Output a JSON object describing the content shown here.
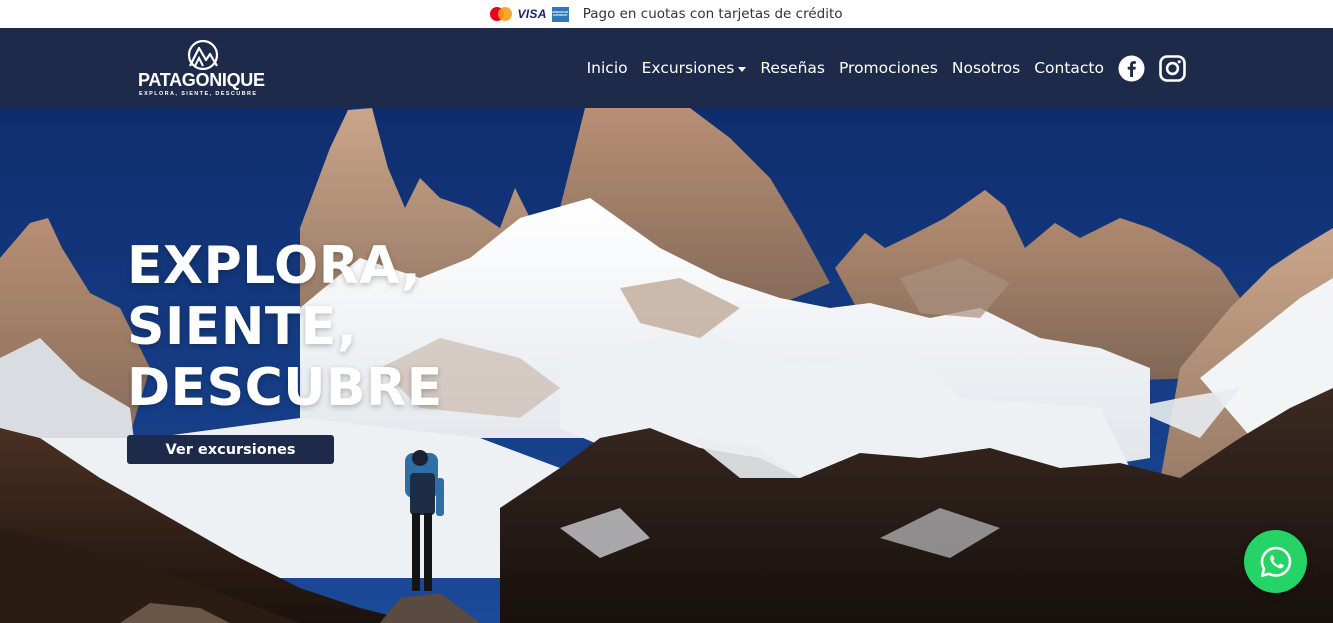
{
  "topbar": {
    "payment_icons": [
      "mastercard-icon",
      "visa-icon",
      "amex-icon"
    ],
    "visa_label": "VISA",
    "amex_label": "AMERICAN EXPRESS",
    "text": "Pago en cuotas con tarjetas de crédito"
  },
  "brand": {
    "name": "PATAGONIQUE",
    "tagline": "EXPLORA, SIENTE, DESCUBRE"
  },
  "nav": {
    "items": [
      {
        "label": "Inicio"
      },
      {
        "label": "Excursiones",
        "dropdown": true
      },
      {
        "label": "Reseñas"
      },
      {
        "label": "Promociones"
      },
      {
        "label": "Nosotros"
      },
      {
        "label": "Contacto"
      }
    ],
    "social": [
      "facebook-icon",
      "instagram-icon"
    ]
  },
  "hero": {
    "title_lines": [
      "EXPLORA,",
      "SIENTE,",
      "DESCUBRE"
    ],
    "button_label": "Ver excursiones"
  },
  "floating": {
    "icon": "whatsapp-icon"
  },
  "colors": {
    "navy": "#1e2a4a",
    "whatsapp": "#25d366",
    "mastercard_red": "#eb001b",
    "mastercard_orange": "#f79e1b",
    "visa_blue": "#1a1f71",
    "amex_blue": "#2e77bb"
  }
}
